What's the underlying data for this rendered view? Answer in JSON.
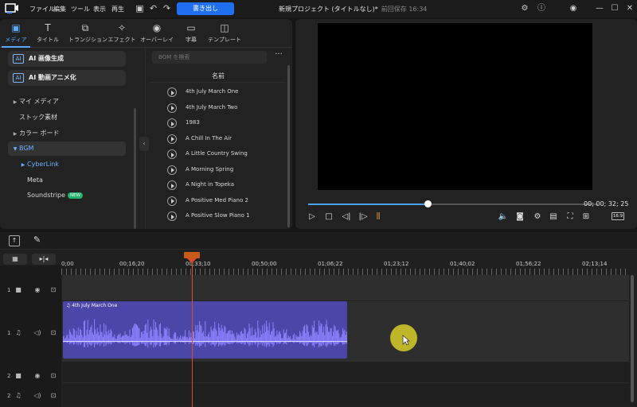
{
  "titlebar": {
    "menus": [
      "ファイル",
      "編集",
      "ツール",
      "表示",
      "再生"
    ],
    "export_label": "書き出し",
    "project_title": "新規プロジェクト (タイトルなし)*",
    "saved_status": "前回保存 16:34"
  },
  "tabs": [
    {
      "label": "メディア",
      "icon": "media-icon",
      "glyph": "▣"
    },
    {
      "label": "タイトル",
      "icon": "title-icon",
      "glyph": "T"
    },
    {
      "label": "トランジション",
      "icon": "transition-icon",
      "glyph": "⧉"
    },
    {
      "label": "エフェクト",
      "icon": "effect-icon",
      "glyph": "✧"
    },
    {
      "label": "オーバーレイ",
      "icon": "overlay-icon",
      "glyph": "◉"
    },
    {
      "label": "字幕",
      "icon": "subtitle-icon",
      "glyph": "▭"
    },
    {
      "label": "テンプレート",
      "icon": "template-icon",
      "glyph": "◫"
    }
  ],
  "ai_buttons": [
    {
      "label": "AI 画像生成",
      "badge": "AI"
    },
    {
      "label": "AI 動画アニメ化",
      "badge": "AI"
    }
  ],
  "tree": [
    {
      "label": "マイ メディア",
      "arrow": "▶",
      "indent": 16
    },
    {
      "label": "ストック素材",
      "arrow": "",
      "indent": 16
    },
    {
      "label": "カラー ボード",
      "arrow": "▶",
      "indent": 16
    },
    {
      "label": "BGM",
      "arrow": "▼",
      "indent": 16,
      "selected": true
    },
    {
      "label": "CyberLink",
      "arrow": "▶",
      "indent": 26,
      "active": true
    },
    {
      "label": "Meta",
      "arrow": "",
      "indent": 26
    },
    {
      "label": "Soundstripe",
      "arrow": "",
      "indent": 26,
      "badge": "NEW"
    }
  ],
  "search": {
    "placeholder": "BGM を検索"
  },
  "list": {
    "column_header": "名前",
    "tracks": [
      "4th July March One",
      "4th July March Two",
      "1983",
      "A Chill In The Air",
      "A Little Country Swing",
      "A Morning Spring",
      "A Night in Topeka",
      "A Positive Med Piano 2",
      "A Positive Slow Piano 1"
    ]
  },
  "player": {
    "timecode": "00; 00; 32; 25",
    "progress": 0.41,
    "ratio": "16:9"
  },
  "timeline": {
    "ruler": [
      "0;00",
      "00;16;20",
      "00;33;10",
      "00;50;00",
      "01;06;22",
      "01;23;12",
      "01;40;02",
      "01;56;22",
      "02;13;14"
    ],
    "tracks": [
      {
        "num": "1",
        "type": "video"
      },
      {
        "num": "1",
        "type": "audio"
      },
      {
        "num": "2",
        "type": "video"
      },
      {
        "num": "2",
        "type": "audio"
      }
    ],
    "clip_label": "4th July March One"
  },
  "colors": {
    "accent": "#1f6ff0",
    "clip": "#4a47a8",
    "wave": "#8c83ff",
    "playhead": "#e04b2a"
  }
}
